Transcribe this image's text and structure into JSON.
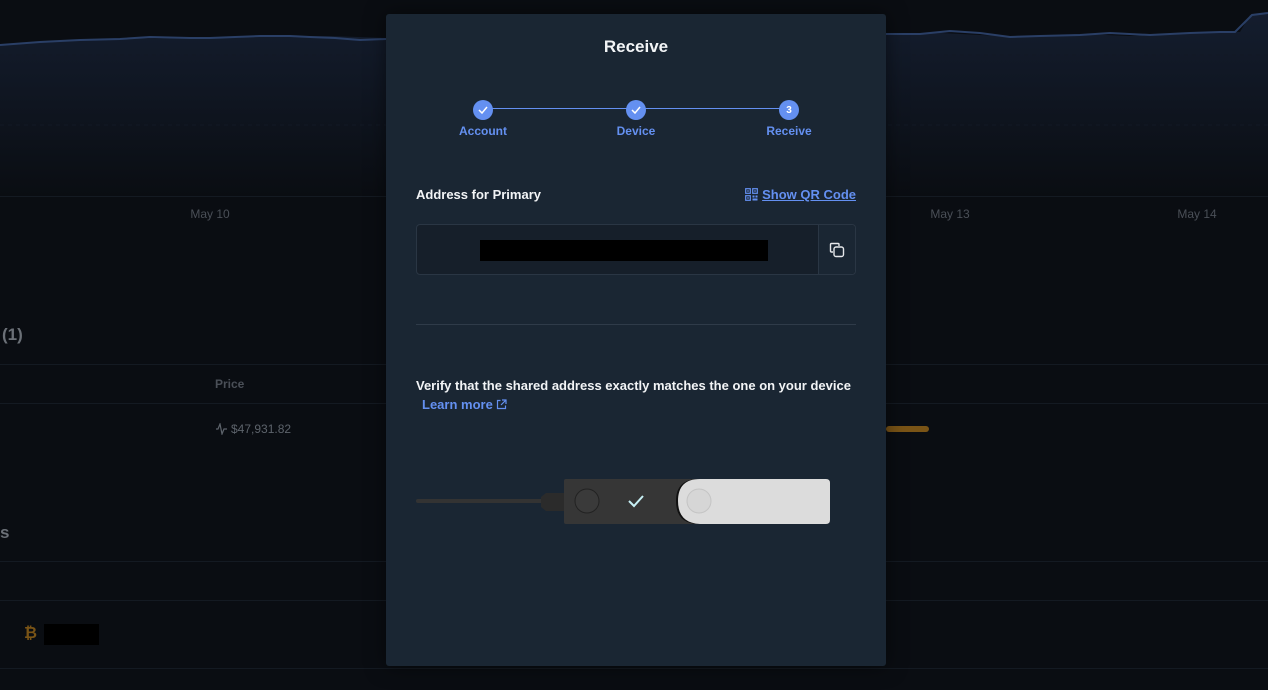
{
  "background": {
    "chart": {
      "x_ticks": [
        "May 10",
        "May 13",
        "May 14"
      ]
    },
    "assets_section_title": "(1)",
    "table_header": {
      "price": "Price"
    },
    "asset_row": {
      "price": "$47,931.82"
    },
    "accounts_section_title": "s",
    "account_row": {
      "currency_icon": "bitcoin-icon"
    }
  },
  "modal": {
    "title": "Receive",
    "steps": [
      {
        "label": "Account",
        "state": "done"
      },
      {
        "label": "Device",
        "state": "done"
      },
      {
        "label": "Receive",
        "state": "active",
        "number": "3"
      }
    ],
    "address_label": "Address for Primary",
    "show_qr_label": "Show QR Code",
    "copy_button_icon": "copy-icon",
    "verify_text": "Verify that the shared address exactly matches the one on your device",
    "learn_more_label": "Learn more"
  },
  "colors": {
    "accent": "#6490f1",
    "modal_bg": "#1a2633",
    "page_bg": "#0a0d12",
    "bitcoin": "#7a5416"
  }
}
